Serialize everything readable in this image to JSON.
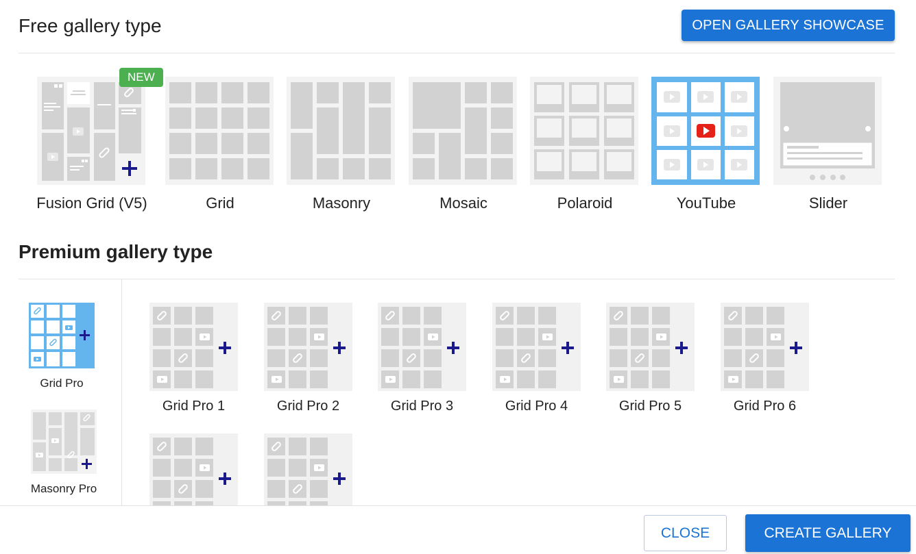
{
  "free_section": {
    "title": "Free gallery type",
    "showcase_button": "OPEN GALLERY SHOWCASE",
    "new_badge": "NEW",
    "types": [
      {
        "label": "Fusion Grid (V5)",
        "icon": "fusion-grid-thumbnail"
      },
      {
        "label": "Grid",
        "icon": "grid-thumbnail"
      },
      {
        "label": "Masonry",
        "icon": "masonry-thumbnail"
      },
      {
        "label": "Mosaic",
        "icon": "mosaic-thumbnail"
      },
      {
        "label": "Polaroid",
        "icon": "polaroid-thumbnail"
      },
      {
        "label": "YouTube",
        "icon": "youtube-thumbnail",
        "selected": true
      },
      {
        "label": "Slider",
        "icon": "slider-thumbnail"
      }
    ]
  },
  "premium_section": {
    "title": "Premium gallery type",
    "categories": [
      {
        "label": "Grid Pro",
        "selected": true
      },
      {
        "label": "Masonry Pro"
      }
    ],
    "items": [
      {
        "label": "Grid Pro 1"
      },
      {
        "label": "Grid Pro 2"
      },
      {
        "label": "Grid Pro 3"
      },
      {
        "label": "Grid Pro 4"
      },
      {
        "label": "Grid Pro 5"
      },
      {
        "label": "Grid Pro 6"
      },
      {
        "label": ""
      },
      {
        "label": ""
      }
    ]
  },
  "footer": {
    "close_button": "CLOSE",
    "create_button": "CREATE GALLERY"
  },
  "colors": {
    "accent": "#1a73d5",
    "selected_blue": "#64b5ee",
    "new_badge": "#4caf50",
    "plus": "#1a1a8c",
    "youtube_red": "#e62117"
  }
}
